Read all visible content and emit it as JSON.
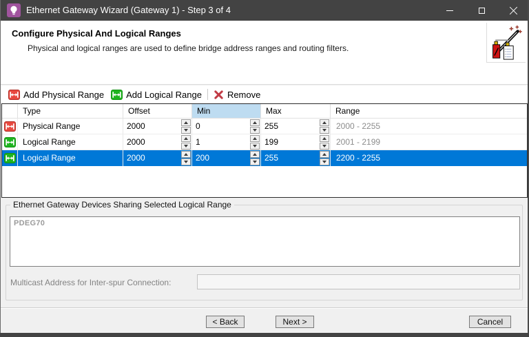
{
  "window": {
    "title": "Ethernet Gateway Wizard (Gateway 1) - Step 3 of 4",
    "icon": "lightbulb-icon"
  },
  "header": {
    "title": "Configure Physical And Logical Ranges",
    "subtitle": "Physical and logical ranges are used to define bridge address ranges and routing filters.",
    "icon": "wizard-wand-icon"
  },
  "toolbar": {
    "add_physical": "Add Physical Range",
    "add_logical": "Add Logical Range",
    "remove": "Remove"
  },
  "table": {
    "columns": [
      "Type",
      "Offset",
      "Min",
      "Max",
      "Range"
    ],
    "sorted_column": "Min",
    "rows": [
      {
        "type": "Physical Range",
        "icon": "physical-range-icon",
        "offset": "2000",
        "min": "0",
        "max": "255",
        "range": "2000 - 2255",
        "selected": false
      },
      {
        "type": "Logical Range",
        "icon": "logical-range-icon",
        "offset": "2000",
        "min": "1",
        "max": "199",
        "range": "2001 - 2199",
        "selected": false
      },
      {
        "type": "Logical Range",
        "icon": "logical-range-icon",
        "offset": "2000",
        "min": "200",
        "max": "255",
        "range": "2200 - 2255",
        "selected": true
      }
    ]
  },
  "devices_group": {
    "title": "Ethernet Gateway Devices Sharing Selected Logical Range",
    "devices": [
      "PDEG70"
    ],
    "multicast_label": "Multicast Address for Inter-spur Connection:",
    "multicast_value": ""
  },
  "footer": {
    "back": "< Back",
    "next": "Next >",
    "cancel": "Cancel"
  },
  "colors": {
    "titlebar": "#434343",
    "selection": "#0078d7",
    "sorted_header": "#bedcf1",
    "physical": "#e8483f",
    "logical": "#1eb41e",
    "remove_x": "#c13b45"
  }
}
